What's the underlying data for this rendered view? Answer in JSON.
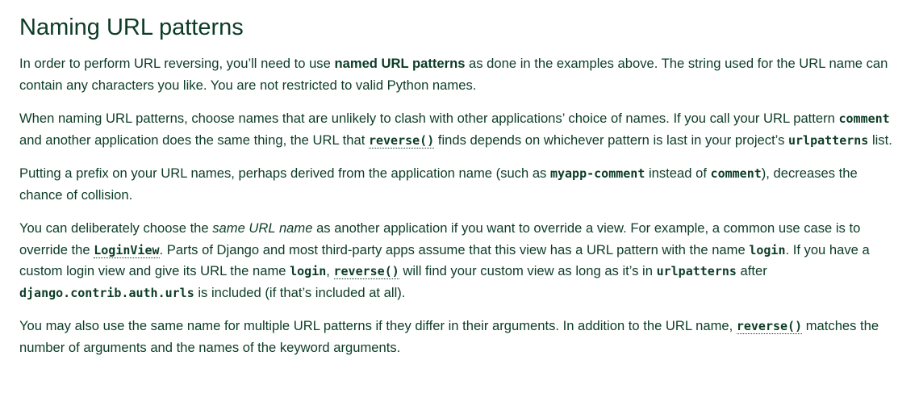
{
  "heading": "Naming URL patterns",
  "p1": {
    "a": "In order to perform URL reversing, you’ll need to use ",
    "b": "named URL patterns",
    "c": " as done in the examples above. The string used for the URL name can contain any characters you like. You are not restricted to valid Python names."
  },
  "p2": {
    "a": "When naming URL patterns, choose names that are unlikely to clash with other applications’ choice of names. If you call your URL pattern ",
    "code1": "comment",
    "b": " and another application does the same thing, the URL that ",
    "link1": "reverse()",
    "c": " finds depends on whichever pattern is last in your project’s ",
    "code2": "urlpatterns",
    "d": " list."
  },
  "p3": {
    "a": "Putting a prefix on your URL names, perhaps derived from the application name (such as ",
    "code1": "myapp-comment",
    "b": " instead of ",
    "code2": "comment",
    "c": "), decreases the chance of collision."
  },
  "p4": {
    "a": "You can deliberately choose the ",
    "em1": "same URL name",
    "b": " as another application if you want to override a view. For example, a common use case is to override the ",
    "link1": "LoginView",
    "c": ". Parts of Django and most third-party apps assume that this view has a URL pattern with the name ",
    "code1": "login",
    "d": ". If you have a custom login view and give its URL the name ",
    "code2": "login",
    "e": ", ",
    "link2": "reverse()",
    "f": " will find your custom view as long as it’s in ",
    "code3": "urlpatterns",
    "g": " after ",
    "code4": "django.contrib.auth.urls",
    "h": " is included (if that’s included at all)."
  },
  "p5": {
    "a": "You may also use the same name for multiple URL patterns if they differ in their arguments. In addition to the URL name, ",
    "link1": "reverse()",
    "b": " matches the number of arguments and the names of the keyword arguments."
  }
}
